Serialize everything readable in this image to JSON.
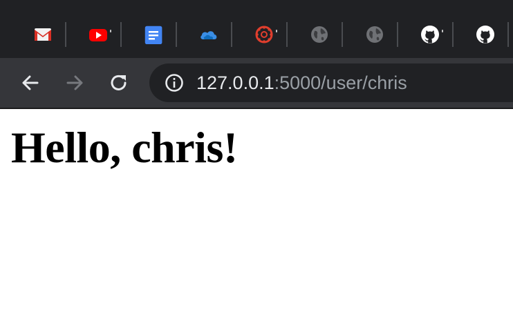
{
  "tabs": [
    {
      "icon": "gmail-icon"
    },
    {
      "icon": "youtube-icon"
    },
    {
      "icon": "google-docs-icon"
    },
    {
      "icon": "onedrive-icon"
    },
    {
      "icon": "canvas-icon"
    },
    {
      "icon": "globe-icon"
    },
    {
      "icon": "globe-icon"
    },
    {
      "icon": "github-icon"
    },
    {
      "icon": "github-icon"
    }
  ],
  "toolbar": {
    "back_icon": "arrow-left-icon",
    "forward_icon": "arrow-right-icon",
    "reload_icon": "reload-icon",
    "site_info_icon": "info-icon"
  },
  "address_bar": {
    "host": "127.0.0.1",
    "path": ":5000/user/chris"
  },
  "page": {
    "heading": "Hello, chris!"
  },
  "colors": {
    "tabstrip_bg": "#202124",
    "toolbar_bg": "#35363a",
    "omnibox_bg": "#202124",
    "url_host": "#e8eaed",
    "url_path": "#9aa0a6"
  }
}
